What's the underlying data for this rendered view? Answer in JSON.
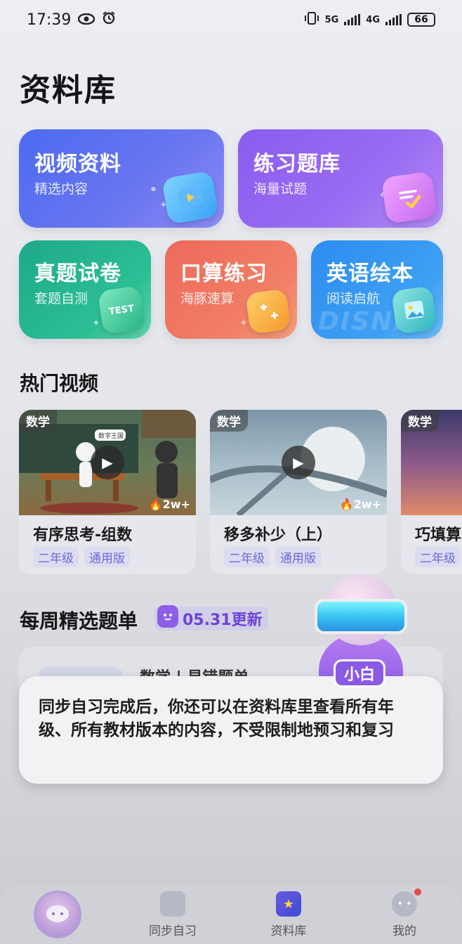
{
  "status": {
    "time": "17:39",
    "battery": "66",
    "net1": "5G",
    "net2": "4G"
  },
  "page_title": "资料库",
  "cards": [
    {
      "title": "视频资料",
      "subtitle": "精选内容"
    },
    {
      "title": "练习题库",
      "subtitle": "海量试题"
    },
    {
      "title": "真题试卷",
      "subtitle": "套题自测",
      "icon_text": "TEST"
    },
    {
      "title": "口算练习",
      "subtitle": "海豚速算"
    },
    {
      "title": "英语绘本",
      "subtitle": "阅读启航",
      "watermark": "DISNEY"
    }
  ],
  "hot_videos": {
    "title": "热门视频",
    "items": [
      {
        "subject": "数学",
        "title": "有序思考-组数",
        "views": "2w+",
        "grade": "二年级",
        "edition": "通用版",
        "sign": "数字王国"
      },
      {
        "subject": "数学",
        "title": "移多补少（上）",
        "views": "2w+",
        "grade": "二年级",
        "edition": "通用版"
      },
      {
        "subject": "数学",
        "title": "巧填算",
        "grade": "二年级"
      }
    ]
  },
  "weekly": {
    "title": "每周精选题单",
    "badge": "05.31更新",
    "item_title": "数学 | 易错题单"
  },
  "assistant": {
    "name": "小白",
    "message": "同步自习完成后，你还可以在资料库里查看所有年级、所有教材版本的内容，不受限制地预习和复习"
  },
  "tabbar": {
    "tabs": [
      {
        "label": "同步自习"
      },
      {
        "label": "资料库"
      },
      {
        "label": "我的"
      }
    ]
  },
  "colors": {
    "accent": "#8a5ae6",
    "video": "#4c6bf2",
    "exercise": "#8a5cf0",
    "exam": "#1ea98a",
    "mental": "#ee6a5c",
    "english": "#2d8cf0"
  }
}
